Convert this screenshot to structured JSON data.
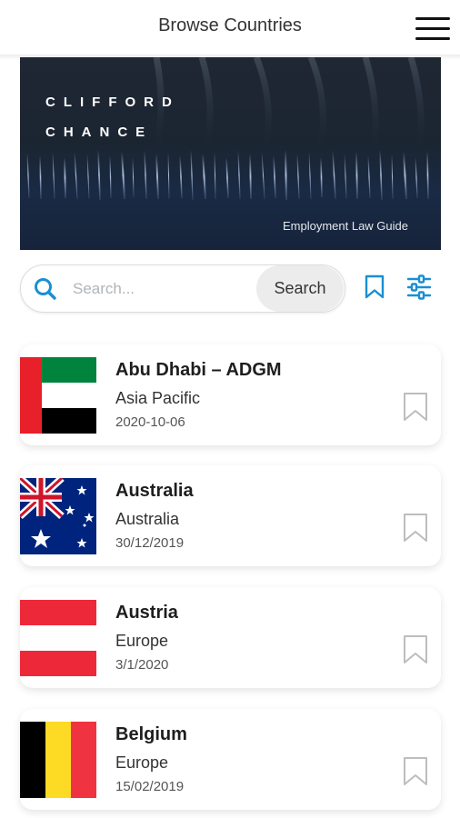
{
  "header": {
    "title": "Browse Countries",
    "menu_icon": "hamburger-menu-icon"
  },
  "banner": {
    "brand_line1": "CLIFFORD",
    "brand_line2": "CHANCE",
    "caption": "Employment Law Guide"
  },
  "search": {
    "placeholder": "Search...",
    "value": "",
    "button_label": "Search",
    "icon": "search-icon"
  },
  "toolbar": {
    "bookmark_icon": "bookmark-icon",
    "filter_icon": "sliders-icon"
  },
  "colors": {
    "accent": "#1a8fd1",
    "bookmark_outline": "#bdbdbd"
  },
  "countries": [
    {
      "name": "Abu Dhabi – ADGM",
      "region": "Asia Pacific",
      "date": "2020-10-06",
      "flag": "uae-flag-icon"
    },
    {
      "name": "Australia",
      "region": "Australia",
      "date": "30/12/2019",
      "flag": "australia-flag-icon"
    },
    {
      "name": "Austria",
      "region": "Europe",
      "date": "3/1/2020",
      "flag": "austria-flag-icon"
    },
    {
      "name": "Belgium",
      "region": "Europe",
      "date": "15/02/2019",
      "flag": "belgium-flag-icon"
    }
  ]
}
